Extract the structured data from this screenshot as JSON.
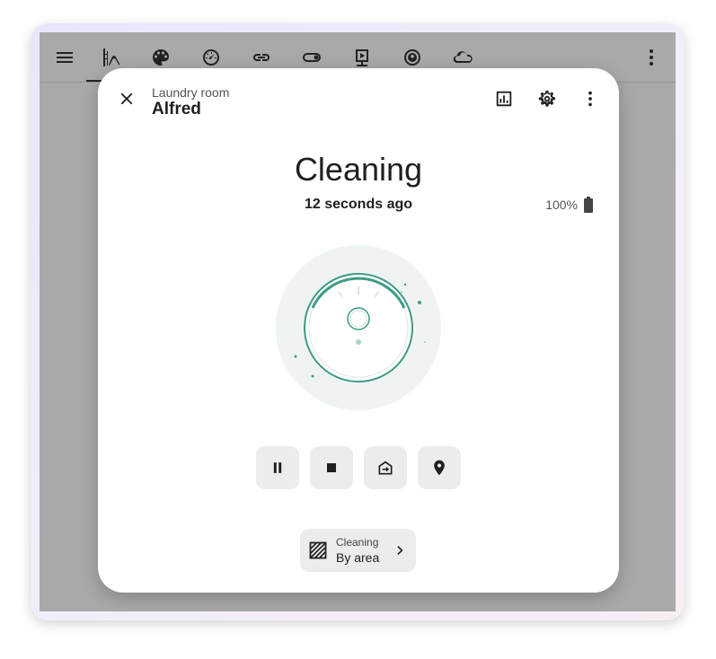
{
  "topbar": {
    "icons": [
      "menu-icon",
      "slide-icon",
      "palette-icon",
      "gauge-icon",
      "link-icon",
      "toggle-icon",
      "media-icon",
      "robot-vacuum-icon",
      "cloud-icon",
      "more-vert-icon"
    ]
  },
  "dialog": {
    "breadcrumb": "Laundry room",
    "title": "Alfred",
    "state": "Cleaning",
    "last_changed": "12 seconds ago",
    "battery": "100%",
    "controls": [
      "pause",
      "stop",
      "return-to-base",
      "locate"
    ],
    "mode": {
      "label": "Cleaning",
      "value": "By area"
    }
  },
  "colors": {
    "accent": "#3e9b85",
    "screen_bg": "#a9a9a9",
    "button_bg": "#ececec"
  }
}
